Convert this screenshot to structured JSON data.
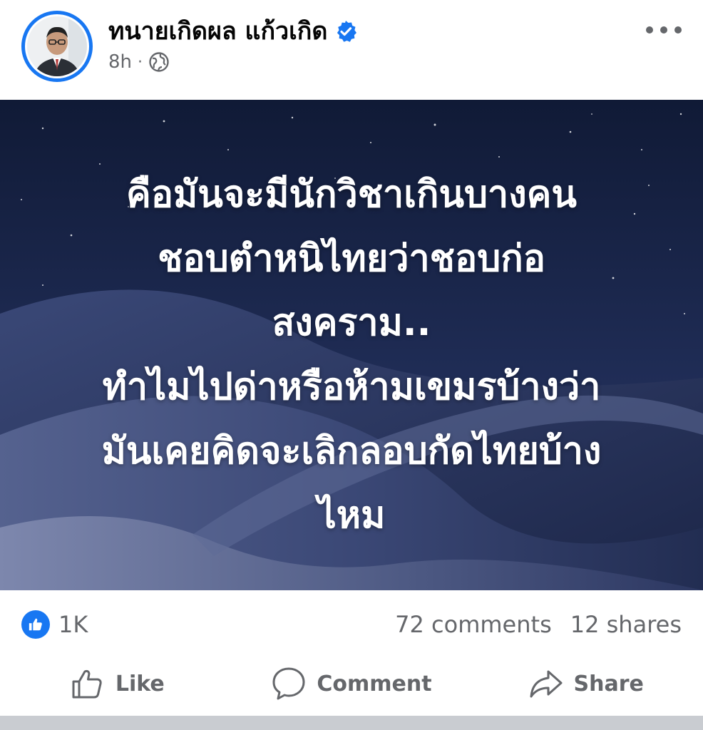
{
  "post": {
    "author_name": "ทนายเกิดผล แก้วเกิด",
    "time": "8h",
    "separator": "·",
    "text": "คือมันจะมีนักวิชาเกินบางคน\nชอบตำหนิไทยว่าชอบก่อ\nสงคราม..\nทำไมไปด่าหรือห้ามเขมรบ้างว่า\nมันเคยคิดจะเลิกลอบกัดไทยบ้าง\nไหม"
  },
  "stats": {
    "likes": "1K",
    "comments": "72 comments",
    "shares": "12 shares"
  },
  "actions": {
    "like_label": "Like",
    "comment_label": "Comment",
    "share_label": "Share"
  },
  "icons": {
    "verified": "verified-badge-icon",
    "privacy": "globe-icon",
    "more": "more-options-icon",
    "like": "thumbs-up-icon",
    "comment": "comment-bubble-icon",
    "share": "share-arrow-icon"
  },
  "colors": {
    "accent": "#1877f2",
    "muted": "#65676b",
    "night_sky": "#1a2547"
  }
}
